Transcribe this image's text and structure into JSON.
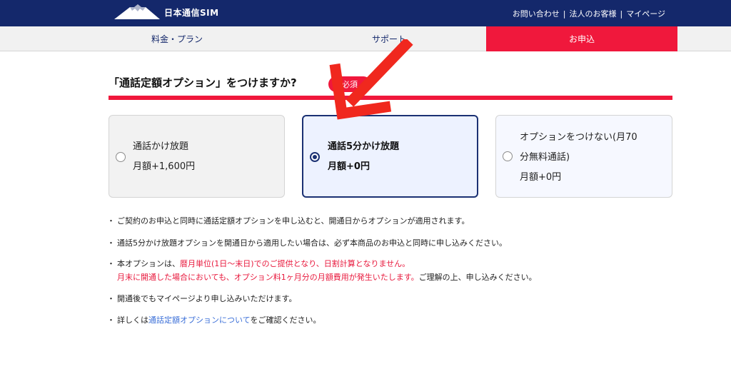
{
  "header": {
    "logo_text": "日本通信SIM",
    "links": [
      "お問い合わせ",
      "法人のお客様",
      "マイページ"
    ],
    "separator": "|",
    "colors": {
      "bar": "#14286b",
      "accent": "#f0183c"
    }
  },
  "nav": {
    "tabs": [
      {
        "label": "料金・プラン",
        "active": false
      },
      {
        "label": "サポート",
        "active": false
      },
      {
        "label": "お申込",
        "active": true
      }
    ]
  },
  "section": {
    "title": "「通話定額オプション」をつけますか?",
    "badge": "必須"
  },
  "options": [
    {
      "line1": "通話かけ放題",
      "line2": "月額+1,600円",
      "line3": "",
      "selected": false
    },
    {
      "line1": "通話5分かけ放題",
      "line2": "月額+0円",
      "line3": "",
      "selected": true
    },
    {
      "line1": "オプションをつけない(月70",
      "line2": "分無料通話)",
      "line3": "月額+0円",
      "selected": false
    }
  ],
  "notes": {
    "bullet": "・",
    "n1": "ご契約のお申込と同時に通話定額オプションを申し込むと、開通日からオプションが適用されます。",
    "n2": "通話5分かけ放題オプションを開通日から適用したい場合は、必ず本商品のお申込と同時に申し込みください。",
    "n3_a": "本オプションは、",
    "n3_b": "暦月単位(1日〜末日)でのご提供となり、日割計算となりません。",
    "n3_c": "月末に開通した場合においても、オプション料1ヶ月分の月額費用が発生いたします。",
    "n3_d": "ご理解の上、申し込みください。",
    "n4": "開通後でもマイページより申し込みいただけます。",
    "n5_a": "詳しくは",
    "n5_link": "通話定額オプションについて",
    "n5_b": "をご確認ください。"
  }
}
